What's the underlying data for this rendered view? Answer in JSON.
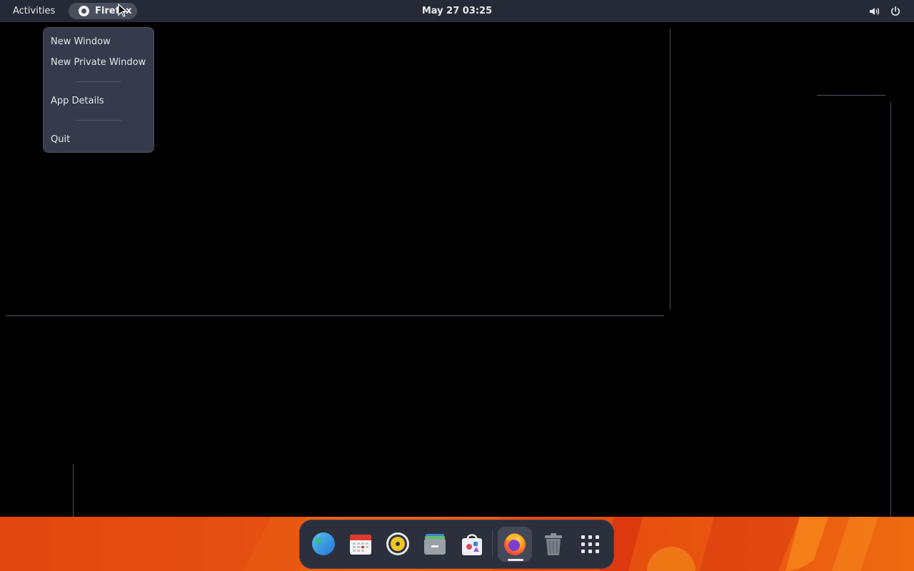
{
  "topbar": {
    "activities_label": "Activities",
    "app_label": "Firefox",
    "datetime": "May 27  03:25"
  },
  "app_menu": {
    "items": [
      {
        "label": "New Window"
      },
      {
        "label": "New Private Window"
      },
      {
        "label": "App Details"
      },
      {
        "label": "Quit"
      }
    ]
  },
  "dock": {
    "apps": [
      {
        "name": "web-browser-icon"
      },
      {
        "name": "calendar-icon"
      },
      {
        "name": "music-player-icon"
      },
      {
        "name": "file-manager-icon"
      },
      {
        "name": "software-store-icon"
      },
      {
        "name": "firefox-icon",
        "active": true
      },
      {
        "name": "trash-icon"
      },
      {
        "name": "app-grid-icon"
      }
    ]
  },
  "colors": {
    "topbar": "#262a36",
    "menu_bg": "#363a4a",
    "dock_bg": "#2c303c",
    "wallpaper": "#e85612"
  }
}
